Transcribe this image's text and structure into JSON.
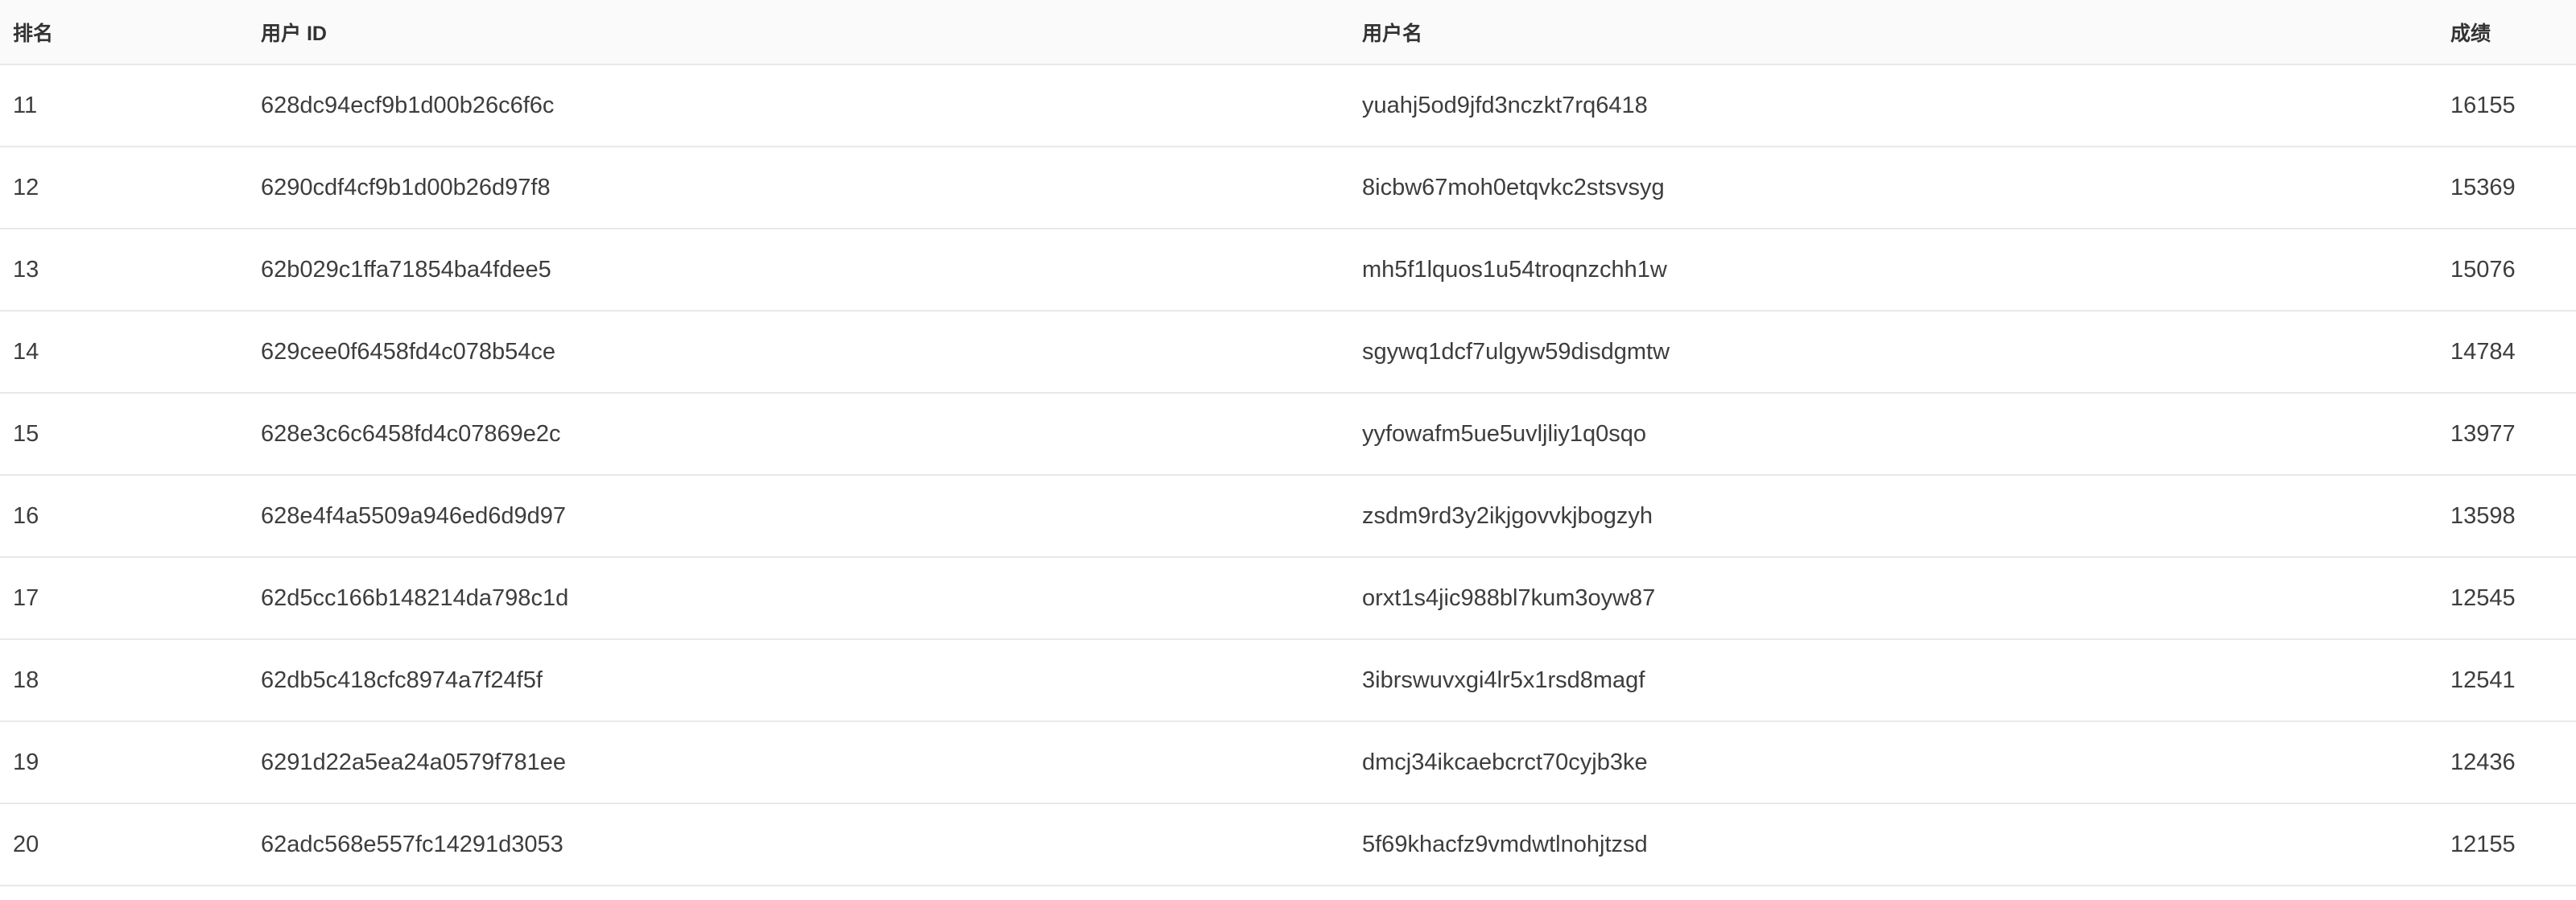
{
  "table": {
    "headers": {
      "rank": "排名",
      "user_id": "用户 ID",
      "username": "用户名",
      "score": "成绩"
    },
    "rows": [
      {
        "rank": "11",
        "user_id": "628dc94ecf9b1d00b26c6f6c",
        "username": "yuahj5od9jfd3nczkt7rq6418",
        "score": "16155"
      },
      {
        "rank": "12",
        "user_id": "6290cdf4cf9b1d00b26d97f8",
        "username": "8icbw67moh0etqvkc2stsvsyg",
        "score": "15369"
      },
      {
        "rank": "13",
        "user_id": "62b029c1ffa71854ba4fdee5",
        "username": "mh5f1lquos1u54troqnzchh1w",
        "score": "15076"
      },
      {
        "rank": "14",
        "user_id": "629cee0f6458fd4c078b54ce",
        "username": "sgywq1dcf7ulgyw59disdgmtw",
        "score": "14784"
      },
      {
        "rank": "15",
        "user_id": "628e3c6c6458fd4c07869e2c",
        "username": "yyfowafm5ue5uvljliy1q0sqo",
        "score": "13977"
      },
      {
        "rank": "16",
        "user_id": "628e4f4a5509a946ed6d9d97",
        "username": "zsdm9rd3y2ikjgovvkjbogzyh",
        "score": "13598"
      },
      {
        "rank": "17",
        "user_id": "62d5cc166b148214da798c1d",
        "username": "orxt1s4jic988bl7kum3oyw87",
        "score": "12545"
      },
      {
        "rank": "18",
        "user_id": "62db5c418cfc8974a7f24f5f",
        "username": "3ibrswuvxgi4lr5x1rsd8magf",
        "score": "12541"
      },
      {
        "rank": "19",
        "user_id": "6291d22a5ea24a0579f781ee",
        "username": "dmcj34ikcaebcrct70cyjb3ke",
        "score": "12436"
      },
      {
        "rank": "20",
        "user_id": "62adc568e557fc14291d3053",
        "username": "5f69khacfz9vmdwtlnohjtzsd",
        "score": "12155"
      }
    ]
  }
}
